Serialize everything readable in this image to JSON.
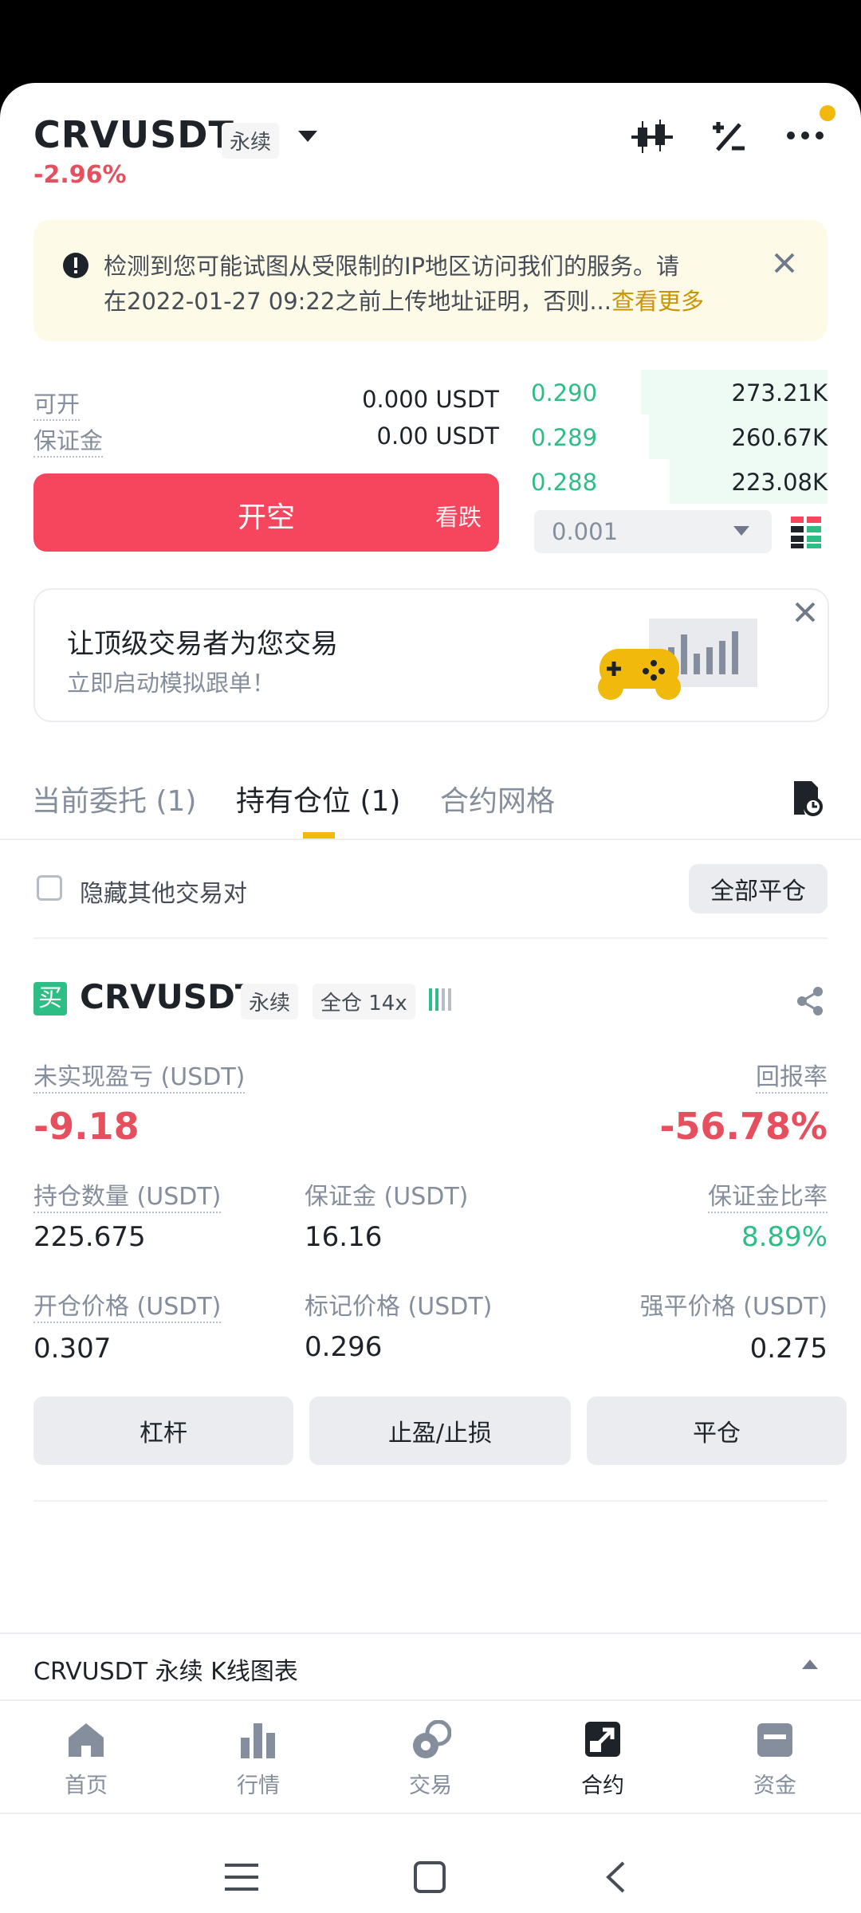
{
  "header": {
    "symbol": "CRVUSDT",
    "type_badge": "永续",
    "change": "-2.96%"
  },
  "notice": {
    "line1": "检测到您可能试图从受限制的IP地区访问我们的服务。请",
    "line2_prefix": "在2022-01-27 09:22之前上传地址证明，否则...",
    "link": "查看更多"
  },
  "account": {
    "available_label": "可开",
    "available_value": "0.000 USDT",
    "margin_label": "保证金",
    "margin_value": "0.00 USDT"
  },
  "short_button": {
    "label": "开空",
    "sub": "看跌"
  },
  "orderbook": {
    "rows": [
      {
        "price": "0.290",
        "qty": "273.21K"
      },
      {
        "price": "0.289",
        "qty": "260.67K"
      },
      {
        "price": "0.288",
        "qty": "223.08K"
      }
    ],
    "precision": "0.001"
  },
  "promo": {
    "title": "让顶级交易者为您交易",
    "subtitle": "立即启动模拟跟单！"
  },
  "tabs": {
    "open_orders": "当前委托 (1)",
    "positions": "持有仓位 (1)",
    "grid": "合约网格"
  },
  "filter": {
    "hide_label": "隐藏其他交易对",
    "close_all": "全部平仓"
  },
  "position": {
    "side_badge": "买",
    "symbol": "CRVUSDT",
    "type_badge": "永续",
    "mode_badge": "全仓 14x",
    "pnl_label": "未实现盈亏 (USDT)",
    "pnl_value": "-9.18",
    "roe_label": "回报率",
    "roe_value": "-56.78%",
    "size_label": "持仓数量 (USDT)",
    "size_value": "225.675",
    "margin_label": "保证金 (USDT)",
    "margin_value": "16.16",
    "margin_ratio_label": "保证金比率",
    "margin_ratio_value": "8.89%",
    "entry_label": "开仓价格 (USDT)",
    "entry_value": "0.307",
    "mark_label": "标记价格 (USDT)",
    "mark_value": "0.296",
    "liq_label": "强平价格 (USDT)",
    "liq_value": "0.275",
    "btn_leverage": "杠杆",
    "btn_tpsl": "止盈/止损",
    "btn_close": "平仓"
  },
  "chart_bar": {
    "label": "CRVUSDT 永续 K线图表"
  },
  "bottom_nav": [
    {
      "label": "首页",
      "icon": "home-icon"
    },
    {
      "label": "行情",
      "icon": "markets-icon"
    },
    {
      "label": "交易",
      "icon": "trade-icon"
    },
    {
      "label": "合约",
      "icon": "futures-icon"
    },
    {
      "label": "资金",
      "icon": "wallet-icon"
    }
  ],
  "colors": {
    "accent": "#f0b90b",
    "red": "#e64f5e",
    "green": "#2ebd85",
    "short_button": "#f6465d"
  }
}
